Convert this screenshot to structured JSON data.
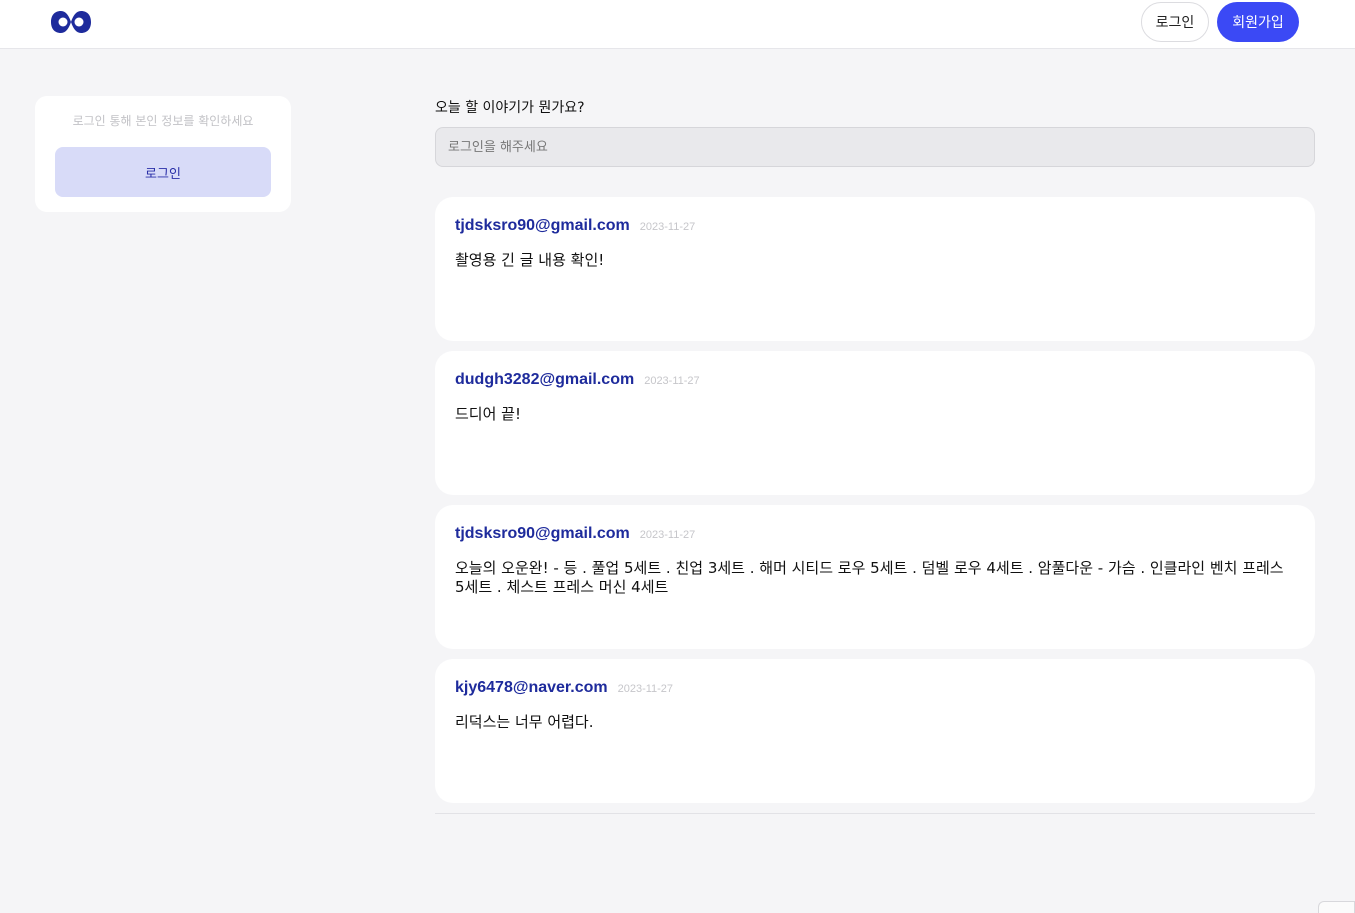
{
  "header": {
    "logo_icon": "infinity-logo",
    "brand_color": "#1e2b9c",
    "login_label": "로그인",
    "signup_label": "회원가입",
    "accent_color": "#3b49f5"
  },
  "sidebar": {
    "hint": "로그인 통해 본인 정보를 확인하세요",
    "login_label": "로그인"
  },
  "compose": {
    "title": "오늘 할 이야기가 뭔가요?",
    "placeholder": "로그인을 해주세요"
  },
  "posts": [
    {
      "author": "tjdsksro90@gmail.com",
      "date": "2023-11-27",
      "body": "촬영용 긴 글 내용 확인!"
    },
    {
      "author": "dudgh3282@gmail.com",
      "date": "2023-11-27",
      "body": "드디어 끝!"
    },
    {
      "author": "tjdsksro90@gmail.com",
      "date": "2023-11-27",
      "body": "오늘의 오운완! - 등 . 풀업 5세트 . 친업 3세트 . 해머 시티드 로우 5세트 . 덤벨 로우 4세트 . 암풀다운 - 가슴 . 인클라인 벤치 프레스 5세트 . 체스트 프레스 머신 4세트"
    },
    {
      "author": "kjy6478@naver.com",
      "date": "2023-11-27",
      "body": "리덕스는 너무 어렵다."
    }
  ]
}
